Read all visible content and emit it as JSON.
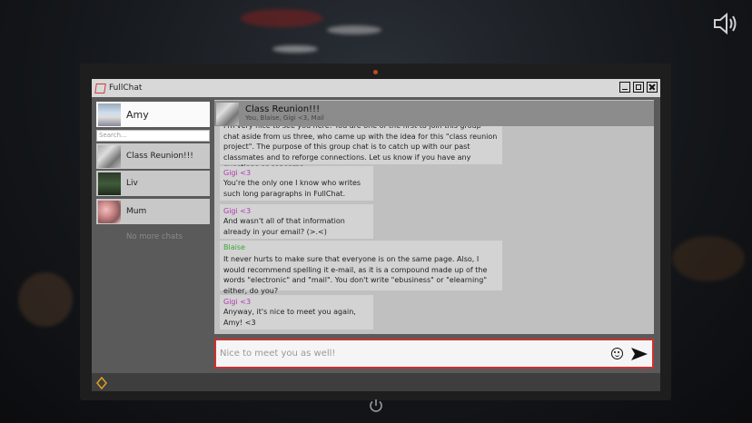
{
  "window": {
    "title": "FullChat"
  },
  "profile": {
    "name": "Amy"
  },
  "search": {
    "placeholder": "Search..."
  },
  "chats": [
    {
      "label": "Class Reunion!!!",
      "thumb": "group"
    },
    {
      "label": "Liv",
      "thumb": "forest"
    },
    {
      "label": "Mum",
      "thumb": "mum"
    }
  ],
  "no_more_chats": "No more chats",
  "chat_header": {
    "name": "Class Reunion!!!",
    "members": "You, Blaise, Gigi <3, Mail"
  },
  "messages": [
    {
      "sender": "",
      "text": "I'm very nice to see you here! You are one of the first to join this group chat aside from us three, who came up with the idea for this \"class reunion project\". The purpose of this group chat is to catch up with our past classmates and to reforge connections. Let us know if you have any questions or concerns."
    },
    {
      "sender": "Gigi <3",
      "text": "You're the only one I know who writes such long paragraphs in FullChat."
    },
    {
      "sender": "Gigi <3",
      "text": "And wasn't all of that information already in your email? (>.<)"
    },
    {
      "sender": "Blaise",
      "text": "It never hurts to make sure that everyone is on the same page. Also, I would recommend spelling it e-mail, as it is a compound made up of the words \"electronic\" and \"mail\". You don't write \"ebusiness\" or \"elearning\" either, do you?"
    },
    {
      "sender": "Gigi <3",
      "text": "Anyway, it's nice to meet you again, Amy! <3"
    }
  ],
  "input": {
    "placeholder": "Nice to meet you as well!"
  },
  "colors": {
    "accent": "#d03030",
    "gigi": "#b03ab0",
    "blaise": "#3aa63a"
  },
  "icons": {
    "speaker": "speaker-icon",
    "emoji": "emoji-icon",
    "send": "send-icon",
    "power": "power-icon",
    "taskbar": "diamond-icon"
  }
}
